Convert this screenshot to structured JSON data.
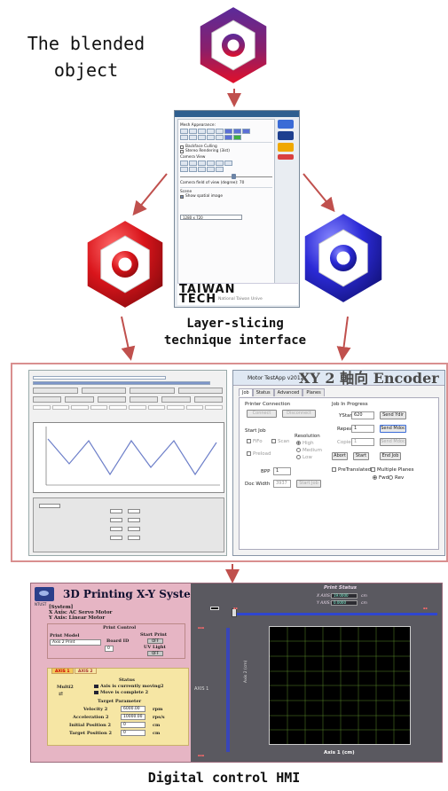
{
  "captions": {
    "blended": [
      "The blended",
      "object"
    ],
    "layer_slicing": [
      "Layer-slicing",
      "technique interface"
    ],
    "hmi": "Digital control HMI"
  },
  "colors": {
    "arrow": "#c0504d",
    "frame_border": "#d98f8f",
    "nut_blended_top": "#5b2b9b",
    "nut_blended_bottom": "#e1102a",
    "nut_red": "#d9151b",
    "nut_blue": "#2b2ad6",
    "hmi_bg": "#e6b5c4",
    "axis_panel": "#f6e6a4"
  },
  "slicer_window": {
    "mesh_appearance_label": "Mesh Appearance:",
    "backface_culling": "Backface Culling",
    "stereo_rendering": "Stereo Rendering (3ist)",
    "camera_view_label": "Camera View",
    "camera_fov": "Camera field of view (degree): 70",
    "scene_label": "Scene",
    "show_spatial": "Show spatial image",
    "resolution": "1280 x 720",
    "logo_line1": "TAIWAN",
    "logo_line2": "TECH",
    "logo_sub": "National Taiwan Unive"
  },
  "encoder_window": {
    "title": "Motor TestApp v2012",
    "overlay_title": "XY 2 軸向 Encoder",
    "tabs": [
      "Job",
      "Status",
      "Advanced",
      "Planes"
    ],
    "printer_connection": "Printer Connection",
    "connect": "Connect",
    "disconnect": "Disconnect",
    "start_job_label": "Start Job",
    "fifo": "FiFo",
    "scan": "Scan",
    "preload": "Preload",
    "resolution_label": "Resolution",
    "res_high": "High",
    "res_medium": "Medium",
    "res_low": "Low",
    "bpp_label": "BPP",
    "bpp_value": "1",
    "doc_width_label": "Doc Width",
    "doc_width_value": "3937",
    "start_job_btn": "Start Job",
    "job_in_progress": "Job In Progress",
    "ystart_label": "YStart",
    "ystart_value": "620",
    "send_ydir": "Send Ydir",
    "repeat_label": "Repeat",
    "repeat_value": "1",
    "send_mdoc": "Send Mdoc",
    "copies_label": "Copies",
    "copies_value": "1",
    "send_mdoc2": "Send Mdoc",
    "abort": "Abort",
    "start": "Start",
    "end_job": "End Job",
    "pre_translated": "PreTranslated",
    "multiple_planes": "Multiple Planes",
    "fwd": "Fwd",
    "rev": "Rev"
  },
  "hmi": {
    "logo": "NTUST",
    "title": "3D Printing X-Y  System",
    "system_label": "[System]",
    "x_axis": "X Axis: AC Servo Motor",
    "y_axis": "Y Axis: Linear Motor",
    "print_control": "Print Control",
    "print_model_label": "Print Model",
    "print_model_value": "Axis 2 Print",
    "board_id_label": "Board ID",
    "board_id_value": "0",
    "start_print_label": "Start Print",
    "start_print_btn": "OFF",
    "uv_light_label": "UV Light",
    "uv_light_btn": "OFF",
    "axis_tabs": [
      "AXIS 1",
      "AXIS 2"
    ],
    "status_label": "Status",
    "multi2": "Multi2",
    "status_moving": "Axis is currently moving2",
    "status_complete": "Move is complete 2",
    "target_parameter": "Target Parameter",
    "velocity_label": "Velocity 2",
    "velocity_value": "6000.00",
    "velocity_unit": "rpm",
    "accel_label": "Acceleration 2",
    "accel_value": "10000.00",
    "accel_unit": "rps/s",
    "init_pos_label": "Initial Position 2",
    "init_pos_value": "0",
    "init_pos_unit": "cm",
    "target_pos_label": "Target Position 2",
    "target_pos_value": "0",
    "target_pos_unit": "cm",
    "print_status": "Print Status",
    "x_axis_read": "X AXIS:",
    "x_axis_value": "19.0000",
    "y_axis_read": "Y AXIS:",
    "y_axis_value": "0.0000",
    "unit_cm": "cm",
    "axis1_label": "AXIS 1",
    "axis2_label": "Axis 2 (cm)",
    "x_axis_title": "Axis 1 (cm)"
  }
}
